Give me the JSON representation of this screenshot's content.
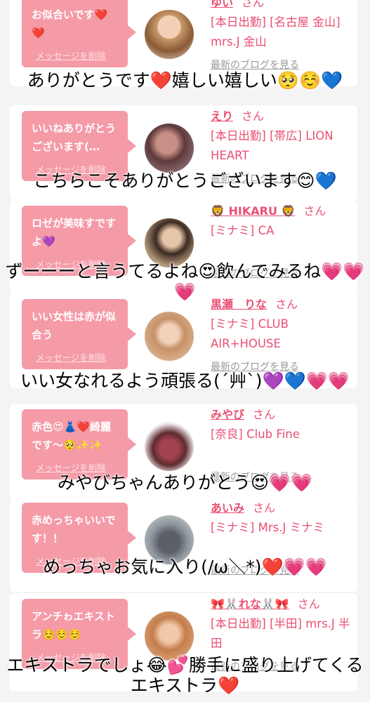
{
  "messages": [
    {
      "bubble": "お似合いです❤️❤️",
      "delete": "メッセージを削除",
      "name": "ゆい",
      "honor": "さん",
      "shop": "[本日出勤] [名古屋 金山] mrs.J 金山",
      "blog": "最新のブログを見る"
    },
    {
      "bubble": "いいねありがとうございます(…",
      "delete": "メッセージを削除",
      "name": "えり",
      "honor": "さん",
      "shop": "[本日出勤] [帯広] LION HEART",
      "blog": "最新のブログを見る"
    },
    {
      "bubble": "ロゼが美味すですよ💜",
      "delete": "メッセージを削除",
      "name": "🦁 HIKARU 🦁",
      "honor": "さん",
      "shop": "[ミナミ] CA",
      "blog": "最新のブログを見る"
    },
    {
      "bubble": "いい女性は赤が似合う",
      "delete": "メッセージを削除",
      "name": "黒瀬　りな",
      "honor": "さん",
      "shop": "[ミナミ] CLUB AIR+HOUSE",
      "blog": "最新のブログを見る"
    },
    {
      "bubble": "赤色😍👗❤️綺麗です〜🥺✨✨",
      "delete": "メッセージを削除",
      "name": "みやび",
      "honor": "さん",
      "shop": "[奈良] Club Fine",
      "blog": "最新のブログを見る"
    },
    {
      "bubble": "赤めっちゃいいです！！",
      "delete": "メッセージを削除",
      "name": "あいみ",
      "honor": "さん",
      "shop": "[ミナミ] Mrs.J ミナミ",
      "blog": "最新のブログを見る"
    },
    {
      "bubble": "アンチゎエキストラ☺️☺️☺️",
      "delete": "メッセージを削除",
      "name": "🎀🐰れな🐰🎀",
      "honor": "さん",
      "shop": "[本日出勤] [半田] mrs.J 半田",
      "blog": "最新のブログを見る"
    }
  ],
  "overlay": [
    "ありがとうです❤️嬉しい嬉しい🥺☺️💙",
    "こちらこそありがとうございます😊💙",
    "ずーーーと言うてるよね😍飲んでみるね💗💗💗",
    "いい女なれるよう頑張る(´艸`)💜💙💗💗",
    "みやびちゃんありがとう😍💗💗",
    "めっちゃお気に入り(/ω＼*)❤️💗💗",
    "エキストラでしょ😂💕勝手に盛り上げてくるエキストラ❤️"
  ],
  "colors": {
    "accent": "#ea4f72",
    "bubble": "#f59aa7",
    "background": "#f4f4f4"
  }
}
